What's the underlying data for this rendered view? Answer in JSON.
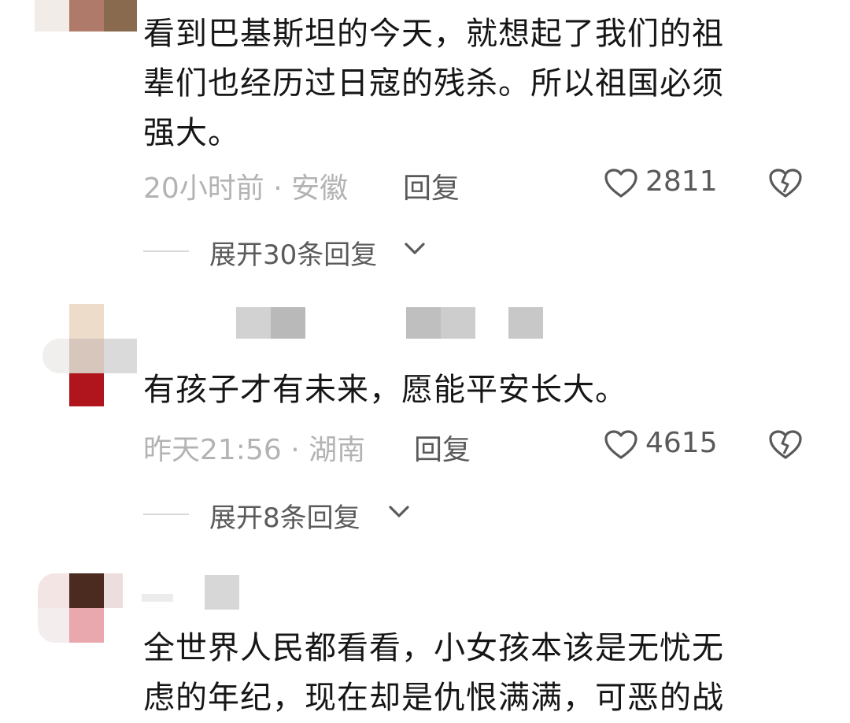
{
  "comments": [
    {
      "text_lines": [
        "看到巴基斯坦的今天，就想起了我们的祖",
        "辈们也经历过日寇的残杀。所以祖国必须",
        "强大。"
      ],
      "time_location": "20小时前 · 安徽",
      "reply_label": "回复",
      "likes": "2811",
      "expand_label": "展开30条回复"
    },
    {
      "text_lines": [
        "有孩子才有未来，愿能平安长大。"
      ],
      "time_location": "昨天21:56 · 湖南",
      "reply_label": "回复",
      "likes": "4615",
      "expand_label": "展开8条回复"
    },
    {
      "text_lines": [
        "全世界人民都看看，小女孩本该是无忧无",
        "虑的年纪，现在却是仇恨满满，可恶的战"
      ]
    }
  ],
  "icons": {
    "like": "heart-outline-icon",
    "dislike": "broken-heart-icon",
    "expand": "chevron-down-icon"
  },
  "colors": {
    "text": "#161616",
    "meta": "#b3b3b3",
    "action": "#595959"
  }
}
